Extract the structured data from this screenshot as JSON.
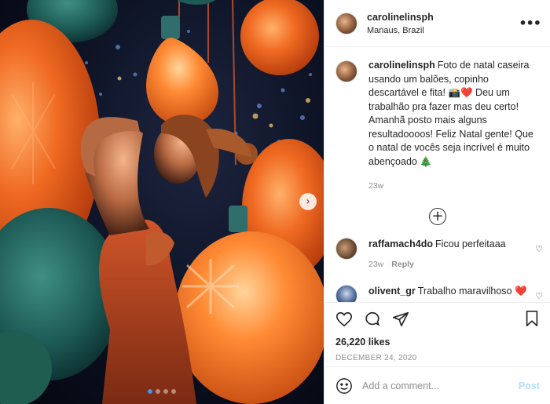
{
  "post": {
    "username": "carolinelinsph",
    "location": "Manaus, Brazil",
    "photo_count": 4,
    "active_photo_index": 0
  },
  "caption": {
    "username": "carolinelinsph",
    "text": "Foto de natal caseira usando um balões, copinho descartável e fita! 📸❤️ Deu um trabalhão pra fazer mas deu certo! Amanhã posto mais alguns resultadoooos! Feliz Natal gente! Que o natal de vocês seja incrível é muito abençoado 🎄",
    "age": "23w"
  },
  "comments": [
    {
      "username": "raffamach4do",
      "text": "Ficou perfeitaaa",
      "age": "23w",
      "reply_label": "Reply"
    },
    {
      "username": "olivent_gr",
      "text": "Trabalho maravilhoso ❤️"
    }
  ],
  "stats": {
    "likes": "26,220 likes",
    "date": "DECEMBER 24, 2020"
  },
  "add_comment": {
    "placeholder": "Add a comment...",
    "post_label": "Post"
  },
  "icons": {
    "more": "more-options-icon",
    "load_more": "plus-circle-icon",
    "next": "chevron-right-icon",
    "like": "heart-icon",
    "comment": "comment-icon",
    "share": "paper-plane-icon",
    "save": "bookmark-icon",
    "emoji": "emoji-icon"
  },
  "colors": {
    "link_blue": "#3897f0",
    "post_disabled": "#b2dffc",
    "muted": "#8e8e8e",
    "text": "#262626"
  }
}
